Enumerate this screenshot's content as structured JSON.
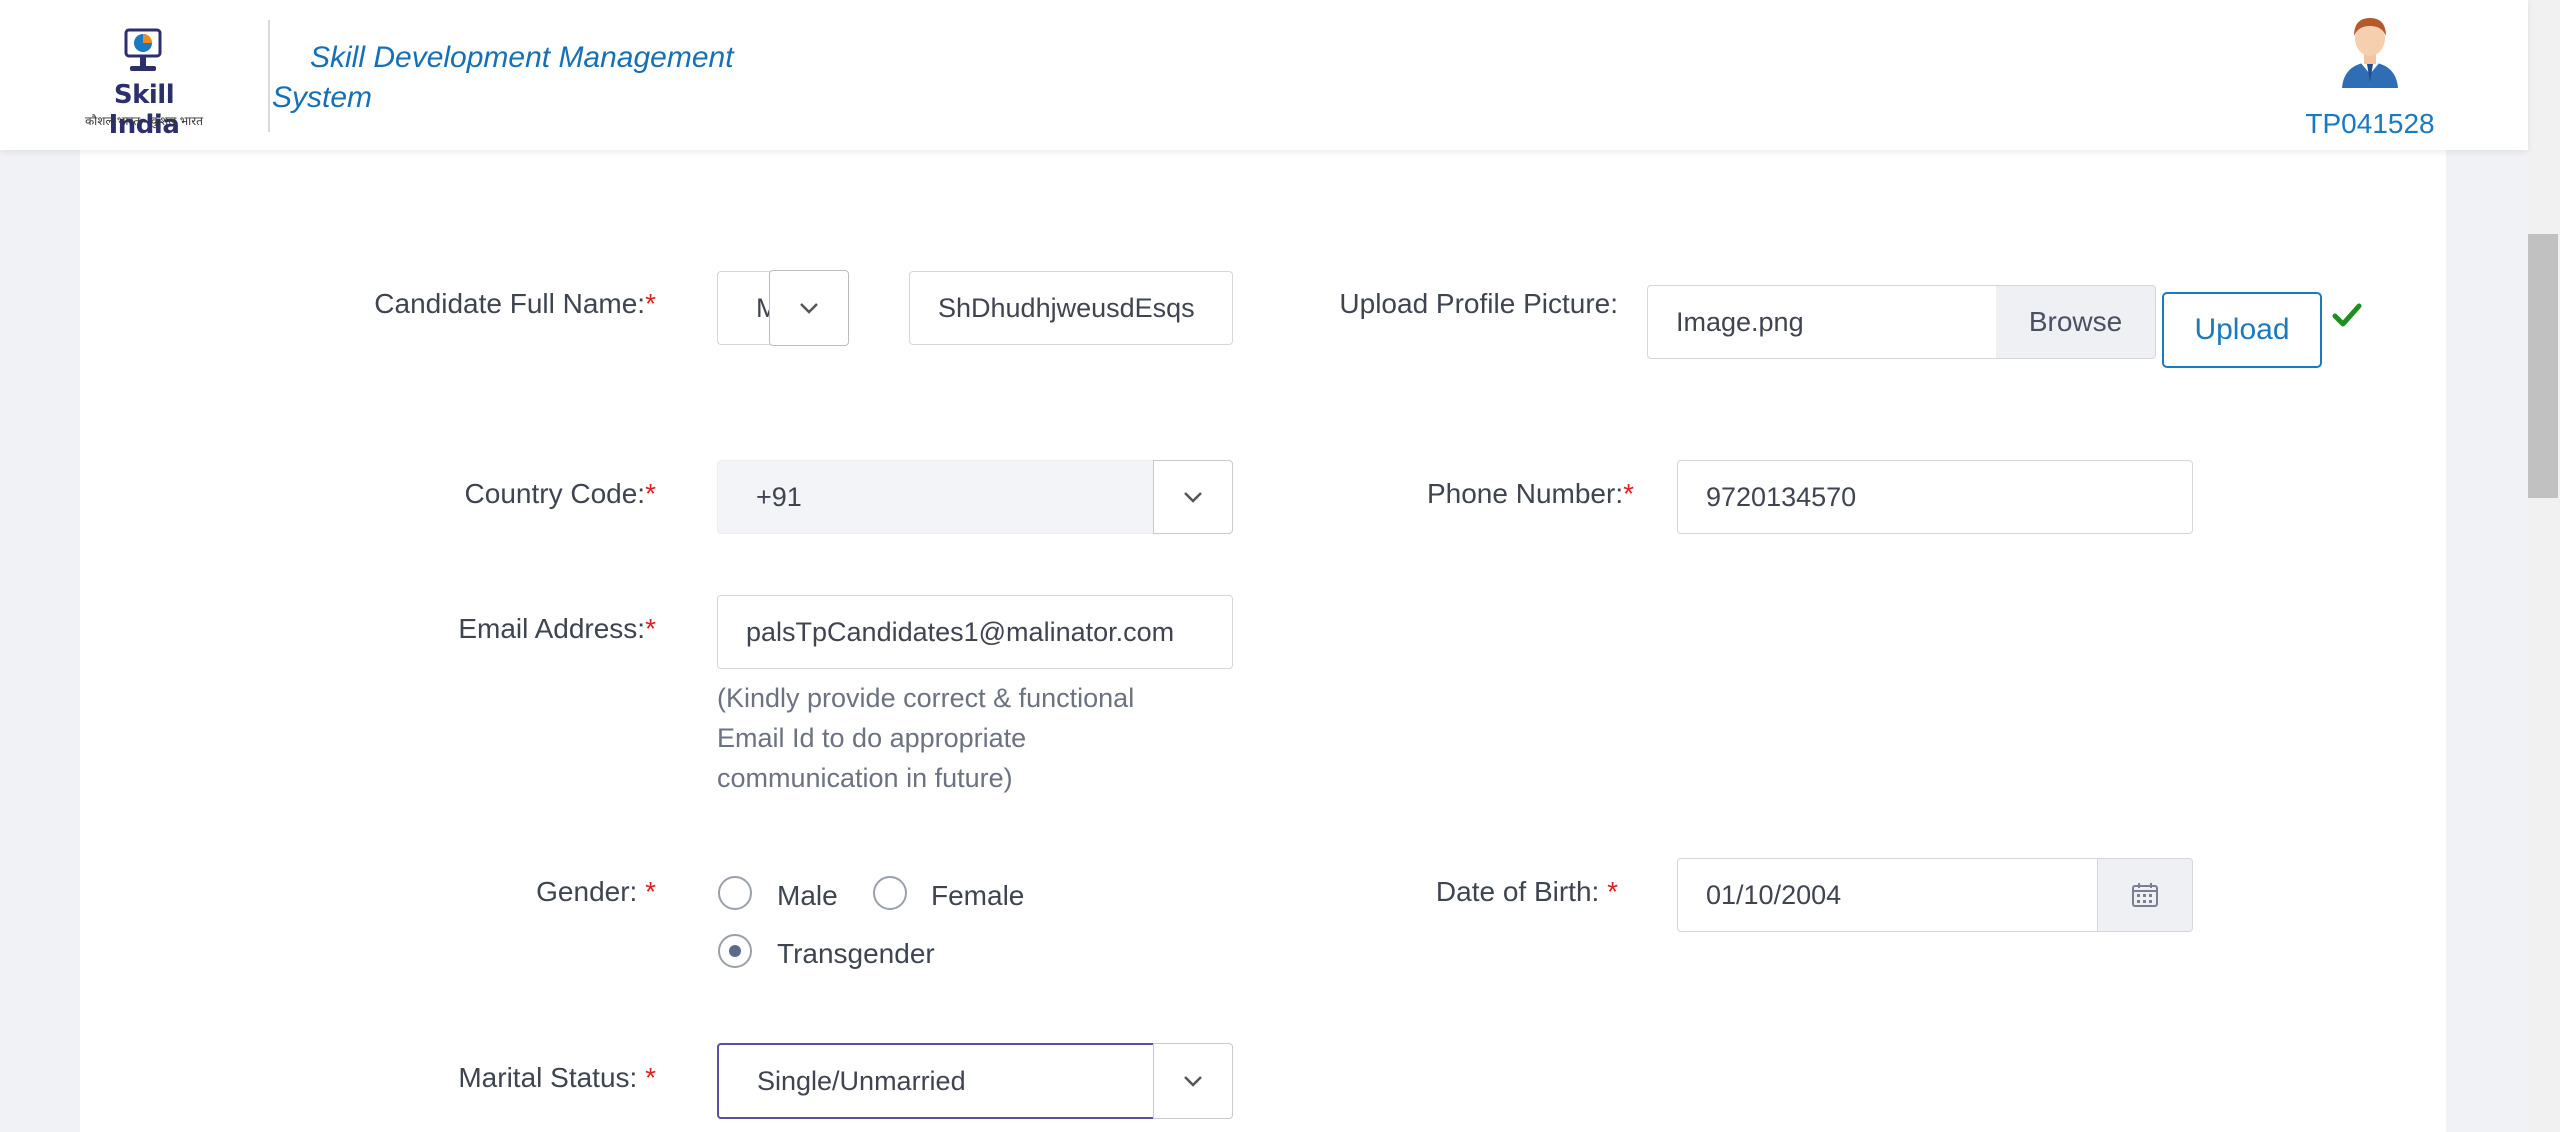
{
  "header": {
    "logo_text": "Skill India",
    "logo_subtext": "कौशल भारत - कुशल भारत",
    "app_title_line1": "Skill Development Management",
    "app_title_line2": "System",
    "user_id": "TP041528"
  },
  "form": {
    "candidate_name": {
      "label": "Candidate Full Name:",
      "required_mark": "*",
      "salutation_value": "Mr",
      "name_value": "ShDhudhjweusdEsqs"
    },
    "profile_picture": {
      "label": "Upload Profile Picture:",
      "file_name": "Image.png",
      "browse_label": "Browse",
      "upload_label": "Upload",
      "status_icon": "check-icon",
      "status_color": "#1e8e1e"
    },
    "country_code": {
      "label": "Country Code:",
      "required_mark": "*",
      "value": "+91"
    },
    "phone_number": {
      "label": "Phone Number:",
      "required_mark": "*",
      "value": "9720134570"
    },
    "email": {
      "label": "Email Address:",
      "required_mark": "*",
      "value": "palsTpCandidates1@malinator.com",
      "help_line1": "(Kindly provide correct & functional",
      "help_line2": "Email Id to do appropriate",
      "help_line3": "communication in future)"
    },
    "gender": {
      "label": "Gender: ",
      "required_mark": "*",
      "options": [
        "Male",
        "Female",
        "Transgender"
      ],
      "selected": "Transgender"
    },
    "dob": {
      "label": "Date of Birth: ",
      "required_mark": "*",
      "value": "01/10/2004"
    },
    "marital_status": {
      "label": "Marital Status: ",
      "required_mark": "*",
      "value": "Single/Unmarried"
    }
  },
  "colors": {
    "accent": "#1a7ac0",
    "required": "#e02020",
    "focus_border": "#5b4ea8"
  }
}
